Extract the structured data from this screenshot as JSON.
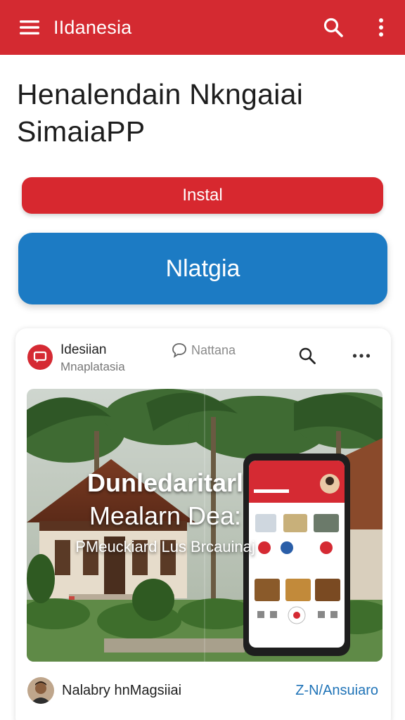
{
  "appbar": {
    "title": "IIdanesia",
    "icons": {
      "menu": "menu-icon",
      "search": "search-icon",
      "more": "more-vertical-icon"
    },
    "color": "#d42a31"
  },
  "headline": "Henalendain Nkngaiai SimaiaPP",
  "buttons": {
    "install_label": "Instal",
    "install_color": "#d7282f",
    "primary_label": "Nlatgia",
    "primary_color": "#1c7bc4"
  },
  "card": {
    "app_name": "Idesiian",
    "app_subtitle": "Mnaplatasia",
    "comment_label": "Nattana",
    "banner": {
      "line1": "Dunledaritarl",
      "line2": "Mealarn Dea:",
      "line3": "PMeuckiard Lus Brcauinaj"
    },
    "author": "Nalabry hnMagsiiai",
    "tag_link": "Z-N/Ansuiaro",
    "tag_color": "#1f73b7"
  }
}
